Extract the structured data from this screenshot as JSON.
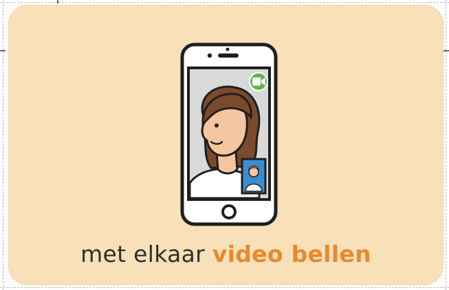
{
  "card": {
    "background_color": "#f8e1b8",
    "accent_color": "#e8892f",
    "text_color": "#2f2f2f"
  },
  "illustration": {
    "icon": "smartphone-video-call-icon",
    "call_badge_icon": "video-camera-icon",
    "call_badge_color": "#5fb84a"
  },
  "caption": {
    "plain": "met elkaar ",
    "highlight": "video bellen"
  }
}
